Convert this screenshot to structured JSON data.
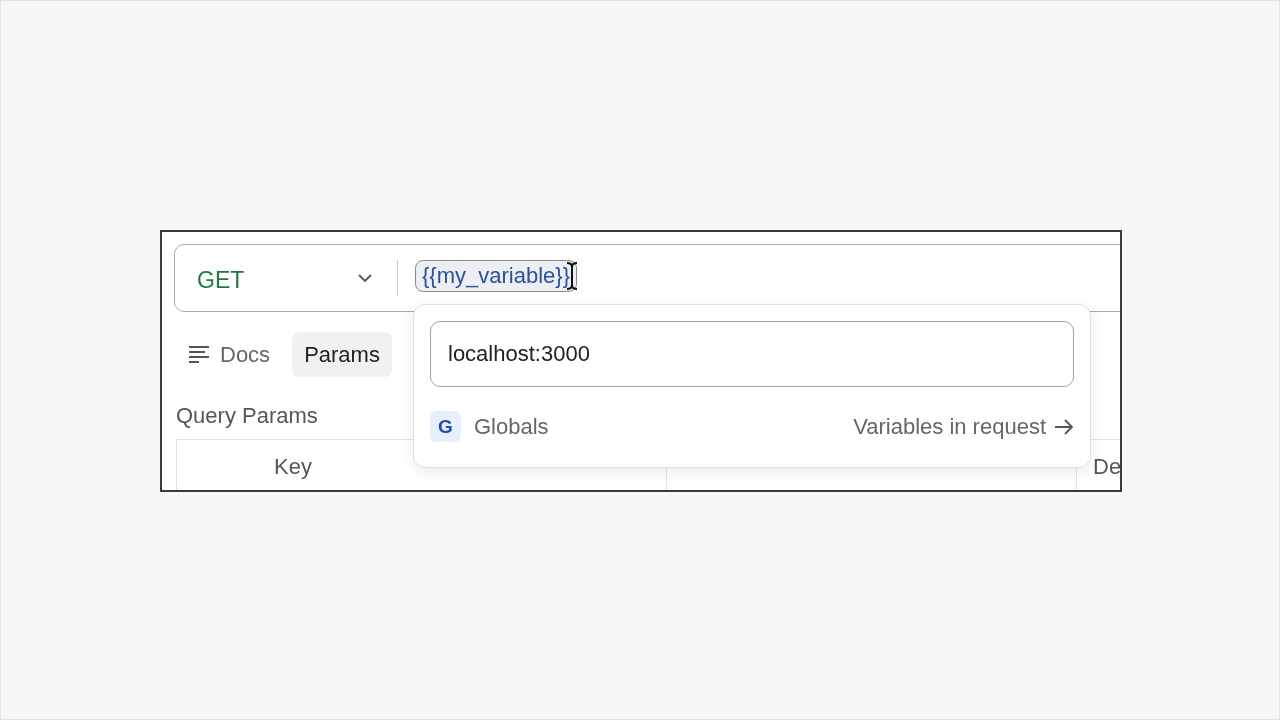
{
  "request": {
    "method": "GET",
    "url_token": "{{my_variable}}"
  },
  "variable_popover": {
    "value": "localhost:3000",
    "scope_badge": "G",
    "scope": "Globals",
    "link": "Variables in request"
  },
  "tabs": [
    {
      "label": "Docs",
      "selected": false,
      "kind": "with_icon"
    },
    {
      "label": "Params",
      "selected": true,
      "kind": "plain"
    }
  ],
  "section_title": "Query Params",
  "table": {
    "column_1": "Key",
    "column_3": "De"
  }
}
